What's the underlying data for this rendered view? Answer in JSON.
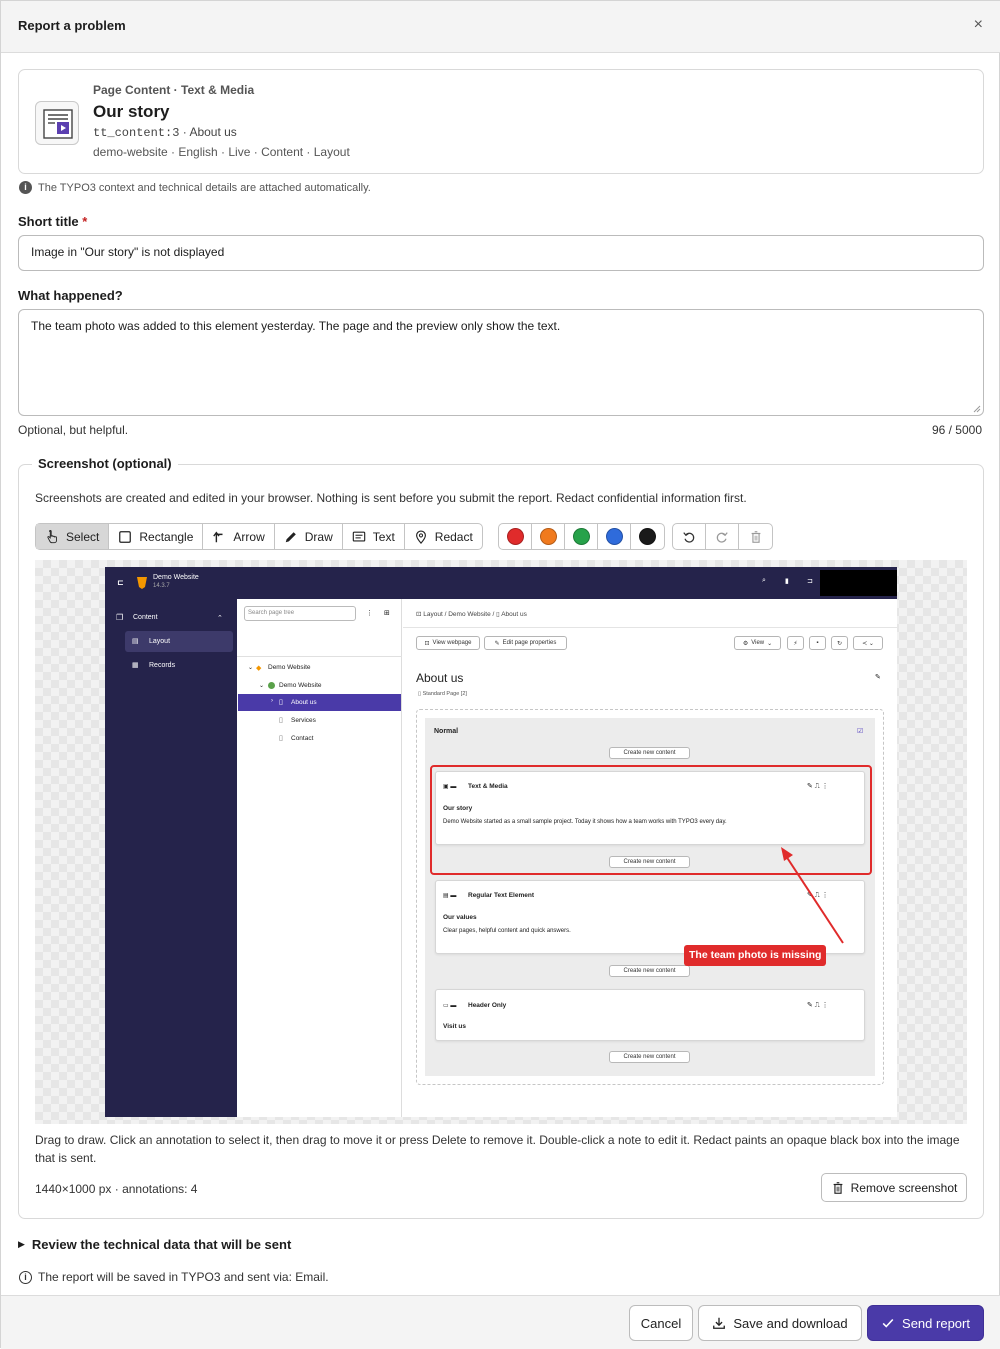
{
  "dialog": {
    "title": "Report a problem",
    "close_symbol": "×"
  },
  "context": {
    "type": "Page Content · Text & Media",
    "title": "Our story",
    "record": "tt_content:3",
    "record_sep": "·",
    "page": "About us",
    "path": "demo-website · English · Live · Content · Layout"
  },
  "context_note": "The TYPO3 context and technical details are attached automatically.",
  "short_title": {
    "label": "Short title",
    "required_mark": "*",
    "value": "Image in \"Our story\" is not displayed"
  },
  "what_happened": {
    "label": "What happened?",
    "value": "The team photo was added to this element yesterday. The page and the preview only show the text.",
    "hint": "Optional, but helpful.",
    "counter": "96 / 5000"
  },
  "screenshot": {
    "legend": "Screenshot (optional)",
    "description": "Screenshots are created and edited in your browser. Nothing is sent before you submit the report. Redact confidential information first.",
    "tools": [
      {
        "label": "Select",
        "icon": "hand-pointer-icon",
        "active": true
      },
      {
        "label": "Rectangle",
        "icon": "square-icon",
        "active": false
      },
      {
        "label": "Arrow",
        "icon": "arrow-icon",
        "active": false
      },
      {
        "label": "Draw",
        "icon": "pencil-icon",
        "active": false
      },
      {
        "label": "Text",
        "icon": "text-note-icon",
        "active": false
      },
      {
        "label": "Redact",
        "icon": "redact-pin-icon",
        "active": false
      }
    ],
    "colors": [
      "#e02b2b",
      "#f07a1e",
      "#27a24a",
      "#2f6bdb",
      "#1a1a1a"
    ],
    "help": "Drag to draw. Click an annotation to select it, then drag to move it or press Delete to remove it. Double-click a note to edit it. Redact paints an opaque black box into the image that is sent.",
    "meta": "1440×1000 px · annotations: 4",
    "remove_label": "Remove screenshot",
    "image": {
      "site_name": "Demo Website",
      "version": "14.3.7",
      "sidebar": {
        "section": "Content",
        "items": [
          "Layout",
          "Records"
        ]
      },
      "tree_search_placeholder": "Search page tree",
      "tree": [
        "Demo Website",
        "Demo Website",
        "About us",
        "Services",
        "Contact"
      ],
      "breadcrumb": [
        "Layout",
        "Demo Website",
        "About us"
      ],
      "btn_view_webpage": "View webpage",
      "btn_edit_page": "Edit page properties",
      "btn_view": "View",
      "page_title": "About us",
      "page_subtitle": "Standard Page [2]",
      "column": "Normal",
      "create_new": "Create new content",
      "elements": [
        {
          "type": "Text & Media",
          "title": "Our story",
          "body": "Demo Website started as a small sample project. Today it shows how a team works with TYPO3 every day."
        },
        {
          "type": "Regular Text Element",
          "title": "Our values",
          "body": "Clear pages, helpful content and quick answers."
        },
        {
          "type": "Header Only",
          "title": "Visit us",
          "body": ""
        }
      ],
      "annotation_text": "The team photo is missing"
    }
  },
  "review_label": "Review the technical data that will be sent",
  "saved_note": "The report will be saved in TYPO3 and sent via: Email.",
  "footer": {
    "cancel": "Cancel",
    "save_download": "Save and download",
    "send": "Send report"
  }
}
